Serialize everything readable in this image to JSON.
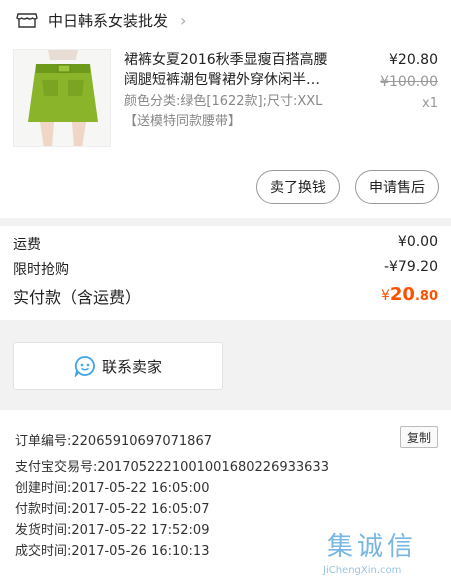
{
  "shop": {
    "name": "中日韩系女装批发",
    "chevron": "›"
  },
  "product": {
    "title": "裙裤女夏2016秋季显瘦百搭高腰阔腿短裤潮包臀裙外穿休闲半…",
    "sku": "颜色分类:绿色[1622款];尺寸:XXL【送模特同款腰带】",
    "price": "¥20.80",
    "original_price": "¥100.00",
    "quantity": "x1"
  },
  "actions": {
    "sell": "卖了换钱",
    "refund": "申请售后"
  },
  "summary": {
    "shipping_label": "运费",
    "shipping_value": "¥0.00",
    "flash_label": "限时抢购",
    "flash_value": "-¥79.20",
    "total_label": "实付款（含运费）",
    "total_symbol": "¥",
    "total_int": "20",
    "total_dec": ".80"
  },
  "contact": {
    "label": "联系卖家"
  },
  "order": {
    "copy_label": "复制",
    "number_label": "订单编号:",
    "number_value": "22065910697071867",
    "alipay_label": "支付宝交易号:",
    "alipay_value": "2017052221001001680226933633",
    "created_label": "创建时间:",
    "created_value": "2017-05-22 16:05:00",
    "paid_label": "付款时间:",
    "paid_value": "2017-05-22 16:05:07",
    "shipped_label": "发货时间:",
    "shipped_value": "2017-05-22 17:52:09",
    "done_label": "成交时间:",
    "done_value": "2017-05-26 16:10:13"
  },
  "watermark": {
    "text": "集诚信",
    "url": "JiChengXin.com"
  },
  "colors": {
    "accent": "#ff5000",
    "icon_blue": "#3ea4e8",
    "skirt_green": "#8ab52a"
  },
  "icons": {
    "store": "store-icon",
    "chat": "chat-bubble-icon"
  }
}
